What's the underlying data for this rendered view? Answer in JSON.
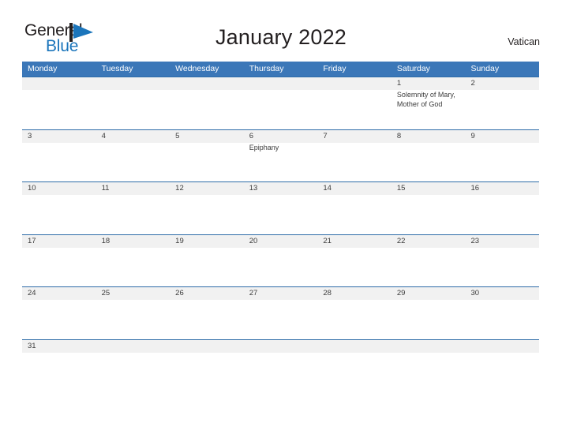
{
  "brand": {
    "word_one": "General",
    "word_two": "Blue",
    "flag_icon": "blue-flag-logo-icon",
    "accent_color": "#1b75bb",
    "text_color": "#231f20"
  },
  "header": {
    "title": "January 2022",
    "country": "Vatican"
  },
  "theme": {
    "header_blue": "#3b77b8",
    "row_border_blue": "#2e6ca8",
    "date_band_gray": "#f1f1f1",
    "text_gray": "#3c3c3c",
    "page_background": "#ffffff"
  },
  "calendar": {
    "month": "January",
    "year": "2022",
    "weekday_headers": [
      "Monday",
      "Tuesday",
      "Wednesday",
      "Thursday",
      "Friday",
      "Saturday",
      "Sunday"
    ],
    "weeks": [
      {
        "days": [
          {
            "number": "",
            "events": []
          },
          {
            "number": "",
            "events": []
          },
          {
            "number": "",
            "events": []
          },
          {
            "number": "",
            "events": []
          },
          {
            "number": "",
            "events": []
          },
          {
            "number": "1",
            "events": [
              "Solemnity of Mary,",
              "Mother of God"
            ]
          },
          {
            "number": "2",
            "events": []
          }
        ]
      },
      {
        "days": [
          {
            "number": "3",
            "events": []
          },
          {
            "number": "4",
            "events": []
          },
          {
            "number": "5",
            "events": []
          },
          {
            "number": "6",
            "events": [
              "Epiphany"
            ]
          },
          {
            "number": "7",
            "events": []
          },
          {
            "number": "8",
            "events": []
          },
          {
            "number": "9",
            "events": []
          }
        ]
      },
      {
        "days": [
          {
            "number": "10",
            "events": []
          },
          {
            "number": "11",
            "events": []
          },
          {
            "number": "12",
            "events": []
          },
          {
            "number": "13",
            "events": []
          },
          {
            "number": "14",
            "events": []
          },
          {
            "number": "15",
            "events": []
          },
          {
            "number": "16",
            "events": []
          }
        ]
      },
      {
        "days": [
          {
            "number": "17",
            "events": []
          },
          {
            "number": "18",
            "events": []
          },
          {
            "number": "19",
            "events": []
          },
          {
            "number": "20",
            "events": []
          },
          {
            "number": "21",
            "events": []
          },
          {
            "number": "22",
            "events": []
          },
          {
            "number": "23",
            "events": []
          }
        ]
      },
      {
        "days": [
          {
            "number": "24",
            "events": []
          },
          {
            "number": "25",
            "events": []
          },
          {
            "number": "26",
            "events": []
          },
          {
            "number": "27",
            "events": []
          },
          {
            "number": "28",
            "events": []
          },
          {
            "number": "29",
            "events": []
          },
          {
            "number": "30",
            "events": []
          }
        ]
      },
      {
        "days": [
          {
            "number": "31",
            "events": []
          },
          {
            "number": "",
            "events": []
          },
          {
            "number": "",
            "events": []
          },
          {
            "number": "",
            "events": []
          },
          {
            "number": "",
            "events": []
          },
          {
            "number": "",
            "events": []
          },
          {
            "number": "",
            "events": []
          }
        ]
      }
    ]
  }
}
